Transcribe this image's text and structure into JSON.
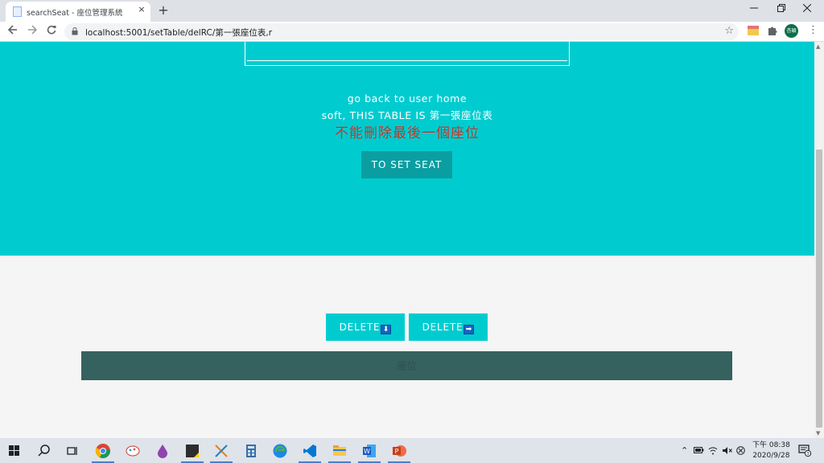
{
  "browser": {
    "tab_title": "searchSeat - 座位管理系統",
    "close_label": "×",
    "new_tab_label": "+",
    "url": "localhost:5001/setTable/delRC/第一張座位表,r",
    "avatar_text": "杏穎"
  },
  "page": {
    "back_link": "go back to user home",
    "table_notice": "soft, THIS TABLE IS 第一張座位表",
    "error_message": "不能刪除最後一個座位",
    "set_seat_button": "TO SET SEAT",
    "delete_row_label": "DELETE",
    "delete_row_arrow": "⬇",
    "delete_col_label": "DELETE",
    "delete_col_arrow": "➡",
    "seat_label": "座位"
  },
  "taskbar": {
    "time": "下午 08:38",
    "date": "2020/9/28",
    "notification_count": "3"
  },
  "colors": {
    "hero": "#00ccd0",
    "set_seat_button": "#0a9ea2",
    "seat_bar": "#35615f",
    "error_text": "#c0392b"
  }
}
